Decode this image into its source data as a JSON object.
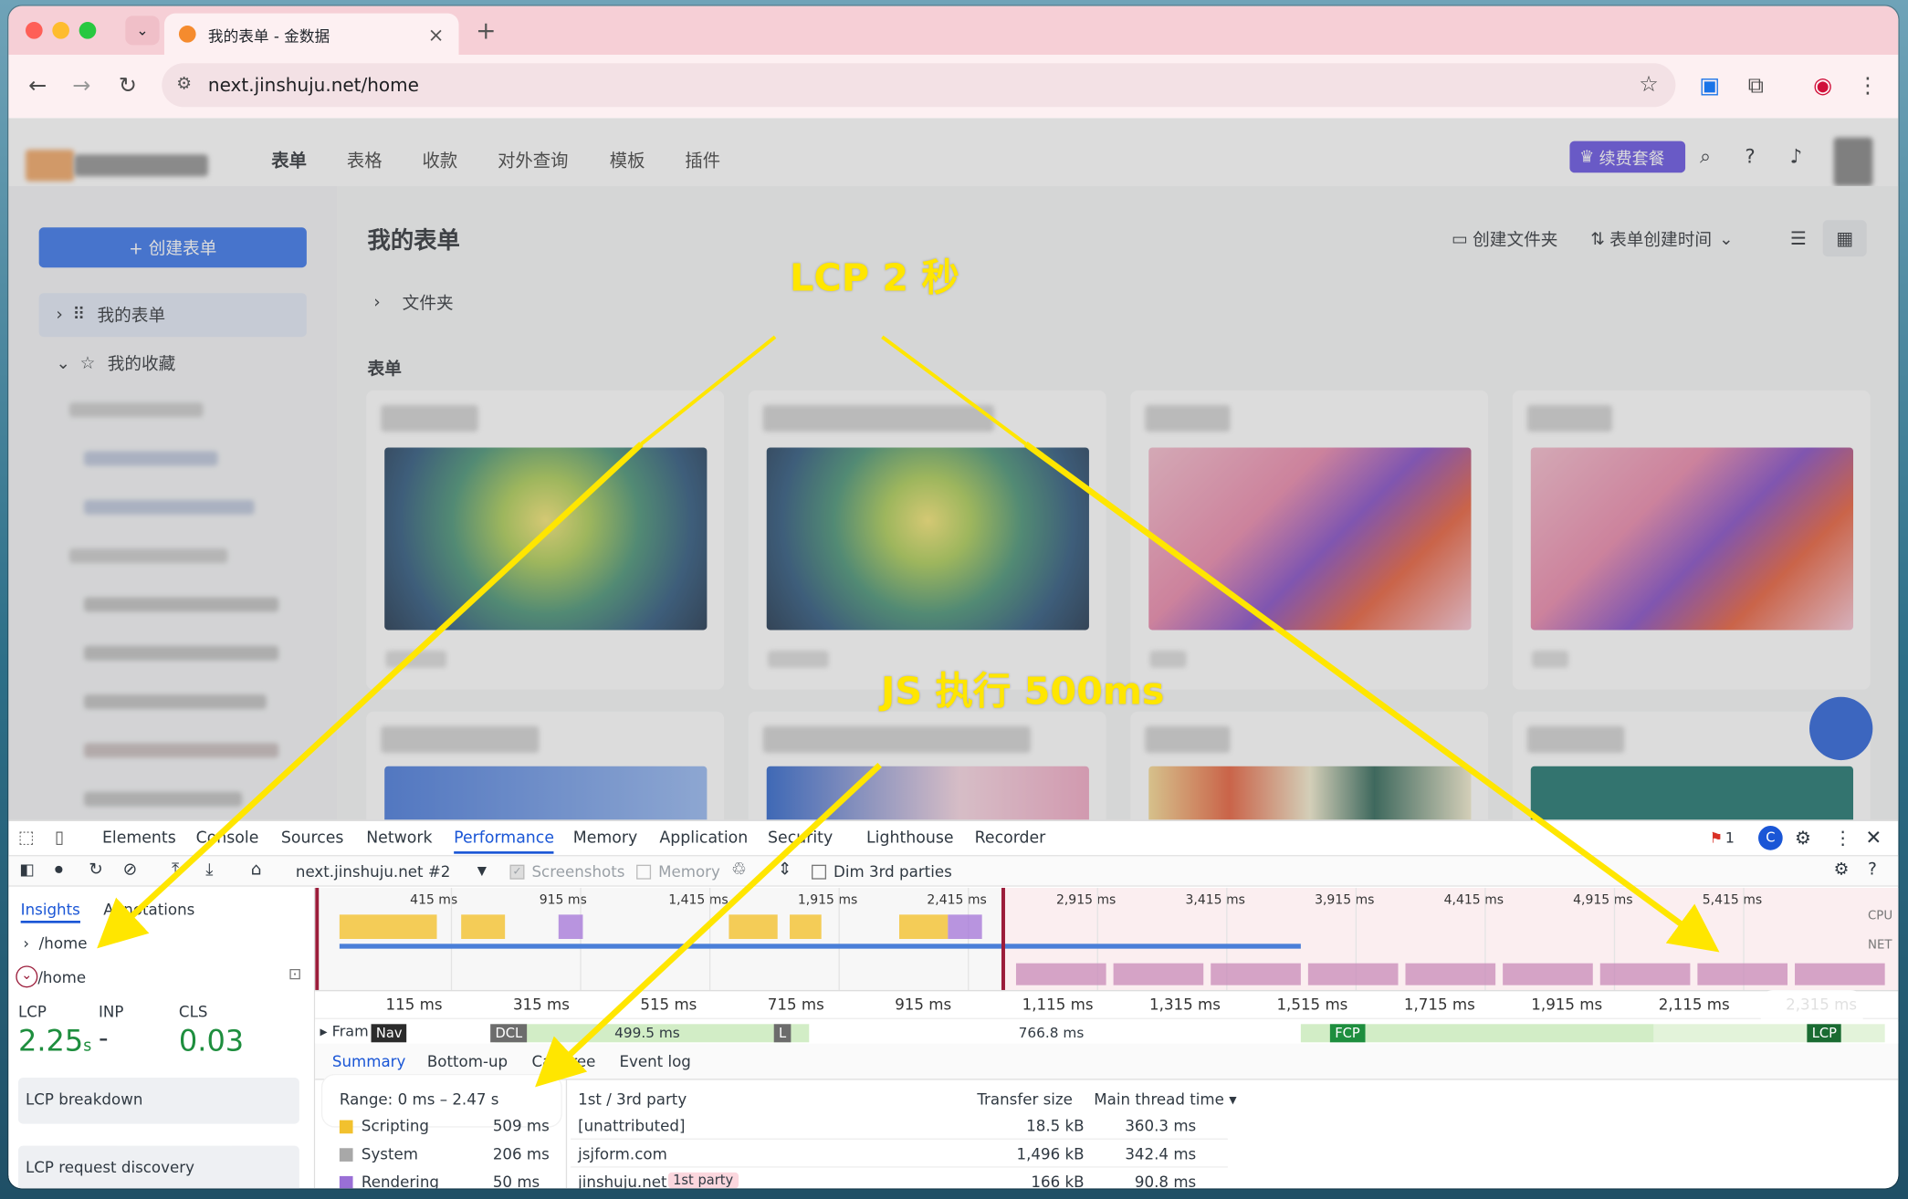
{
  "browser": {
    "tab_title": "我的表单 - 金数据",
    "url": "next.jinshuju.net/home",
    "new_tab": "+",
    "close_tab": "×"
  },
  "app": {
    "nav": [
      "表单",
      "表格",
      "收款",
      "对外查询",
      "模板",
      "插件"
    ],
    "upgrade_button": "续费套餐",
    "create_button": "+ 创建表单",
    "sidebar": {
      "my_forms": "我的表单",
      "favorites": "我的收藏"
    },
    "main": {
      "title": "我的表单",
      "create_folder": "创建文件夹",
      "sort": "表单创建时间",
      "folder_label": "文件夹",
      "forms_label": "表单"
    }
  },
  "devtools": {
    "tabs": [
      "Elements",
      "Console",
      "Sources",
      "Network",
      "Performance",
      "Memory",
      "Application",
      "Security",
      "Lighthouse",
      "Recorder"
    ],
    "active_tab": "Performance",
    "issue_count": "1",
    "recording": "next.jinshuju.net #2",
    "screenshots_label": "Screenshots",
    "memory_label": "Memory",
    "dim_label": "Dim 3rd parties",
    "sidebar_tabs": [
      "Insights",
      "Annotations"
    ],
    "routes": [
      "/home",
      "/home"
    ],
    "metrics": {
      "lcp_label": "LCP",
      "lcp_value": "2.25",
      "lcp_unit": "s",
      "inp_label": "INP",
      "inp_value": "-",
      "cls_label": "CLS",
      "cls_value": "0.03"
    },
    "insights": [
      "LCP breakdown",
      "LCP request discovery"
    ],
    "overview_ticks": [
      "415 ms",
      "915 ms",
      "1,415 ms",
      "1,915 ms",
      "2,415 ms",
      "2,915 ms",
      "3,415 ms",
      "3,915 ms",
      "4,415 ms",
      "4,915 ms",
      "5,415 ms"
    ],
    "lane_labels": [
      "CPU",
      "NET"
    ],
    "detail_ticks": [
      "115 ms",
      "315 ms",
      "515 ms",
      "715 ms",
      "915 ms",
      "1,115 ms",
      "1,315 ms",
      "1,515 ms",
      "1,715 ms",
      "1,915 ms",
      "2,115 ms",
      "2,315 ms"
    ],
    "frames_label": "Fram",
    "markers": {
      "nav": "Nav",
      "dcl": "DCL",
      "l": "L",
      "fcp": "FCP",
      "lcp": "LCP",
      "frame1": "499.5 ms",
      "frame2": "766.8 ms"
    },
    "summary_tabs": [
      "Summary",
      "Bottom-up",
      "Call tree",
      "Event log"
    ],
    "range": "Range: 0 ms – 2.47 s",
    "categories": [
      {
        "name": "Scripting",
        "value": "509 ms",
        "color": "#f2c12e"
      },
      {
        "name": "System",
        "value": "206 ms",
        "color": "#a8a8a8"
      },
      {
        "name": "Rendering",
        "value": "50 ms",
        "color": "#9a6fd6"
      }
    ],
    "table_headers": [
      "1st / 3rd party",
      "Transfer size",
      "Main thread time ▾"
    ],
    "table_rows": [
      {
        "party": "[unattributed]",
        "size": "18.5 kB",
        "time": "360.3 ms",
        "badge": ""
      },
      {
        "party": "jsjform.com",
        "size": "1,496 kB",
        "time": "342.4 ms",
        "badge": ""
      },
      {
        "party": "jinshuju.net",
        "size": "166 kB",
        "time": "90.8 ms",
        "badge": "1st party"
      }
    ]
  },
  "annotations": {
    "lcp_note": "LCP 2 秒",
    "js_note": "JS 执行 500ms",
    "color": "#ffe600"
  }
}
